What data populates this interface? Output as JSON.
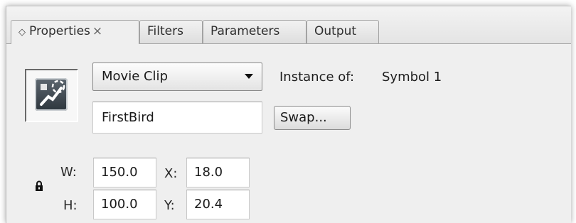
{
  "tabs": [
    {
      "glyph": "◇",
      "label": "Properties",
      "close": "×",
      "active": true
    },
    {
      "label": "Filters",
      "active": false
    },
    {
      "label": "Parameters",
      "active": false
    },
    {
      "label": "Output",
      "active": false
    }
  ],
  "symbol": {
    "icon": "movie-clip-icon",
    "type_options_selected": "Movie Clip",
    "instance_label": "Instance of:",
    "instance_value": "Symbol 1",
    "instance_name": "FirstBird",
    "swap_label": "Swap..."
  },
  "dimensions": {
    "w_label": "W:",
    "w_value": "150.0",
    "h_label": "H:",
    "h_value": "100.0",
    "x_label": "X:",
    "x_value": "18.0",
    "y_label": "Y:",
    "y_value": "20.4",
    "lock_icon": "lock-icon"
  }
}
